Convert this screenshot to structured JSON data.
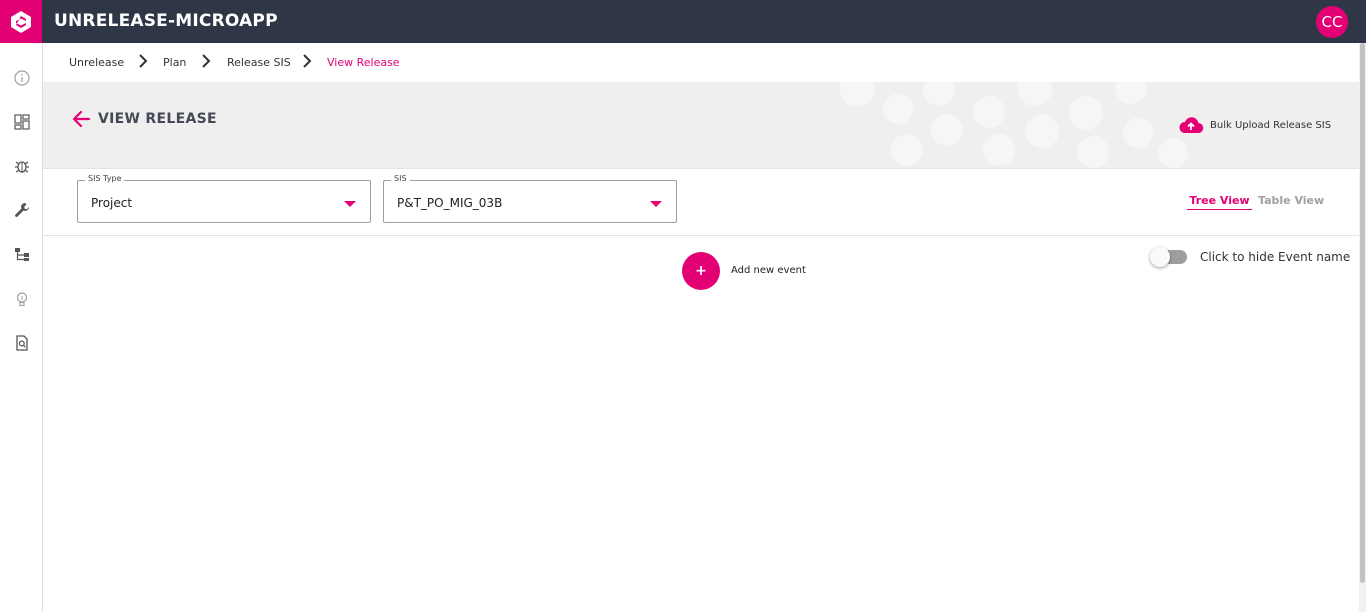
{
  "app": {
    "title": "UNRELEASE-MICROAPP",
    "user_initials": "CC",
    "logo_icon": "brand-logo-icon",
    "colors": {
      "brand": "#e20074",
      "topbar": "#2f3747"
    }
  },
  "sidebar": {
    "items": [
      {
        "icon": "info-icon"
      },
      {
        "icon": "dashboard-icon"
      },
      {
        "icon": "bug-icon"
      },
      {
        "icon": "wrench-icon"
      },
      {
        "icon": "hierarchy-icon"
      },
      {
        "icon": "lightbulb-icon"
      },
      {
        "icon": "document-search-icon"
      }
    ]
  },
  "breadcrumb": {
    "items": [
      "Unrelease",
      "Plan",
      "Release SIS",
      "View Release"
    ]
  },
  "header": {
    "title": "VIEW RELEASE",
    "bulk_upload_label": "Bulk Upload Release SIS"
  },
  "filters": {
    "sis_type": {
      "label": "SIS Type",
      "value": "Project"
    },
    "sis": {
      "label": "SIS",
      "value": "P&T_PO_MIG_03B"
    },
    "tabs": [
      "Tree View",
      "Table View"
    ],
    "active_tab": "Tree View"
  },
  "content": {
    "add_event_label": "Add new event",
    "add_event_symbol": "+",
    "toggle_label": "Click to hide Event name",
    "toggle_on": false
  }
}
